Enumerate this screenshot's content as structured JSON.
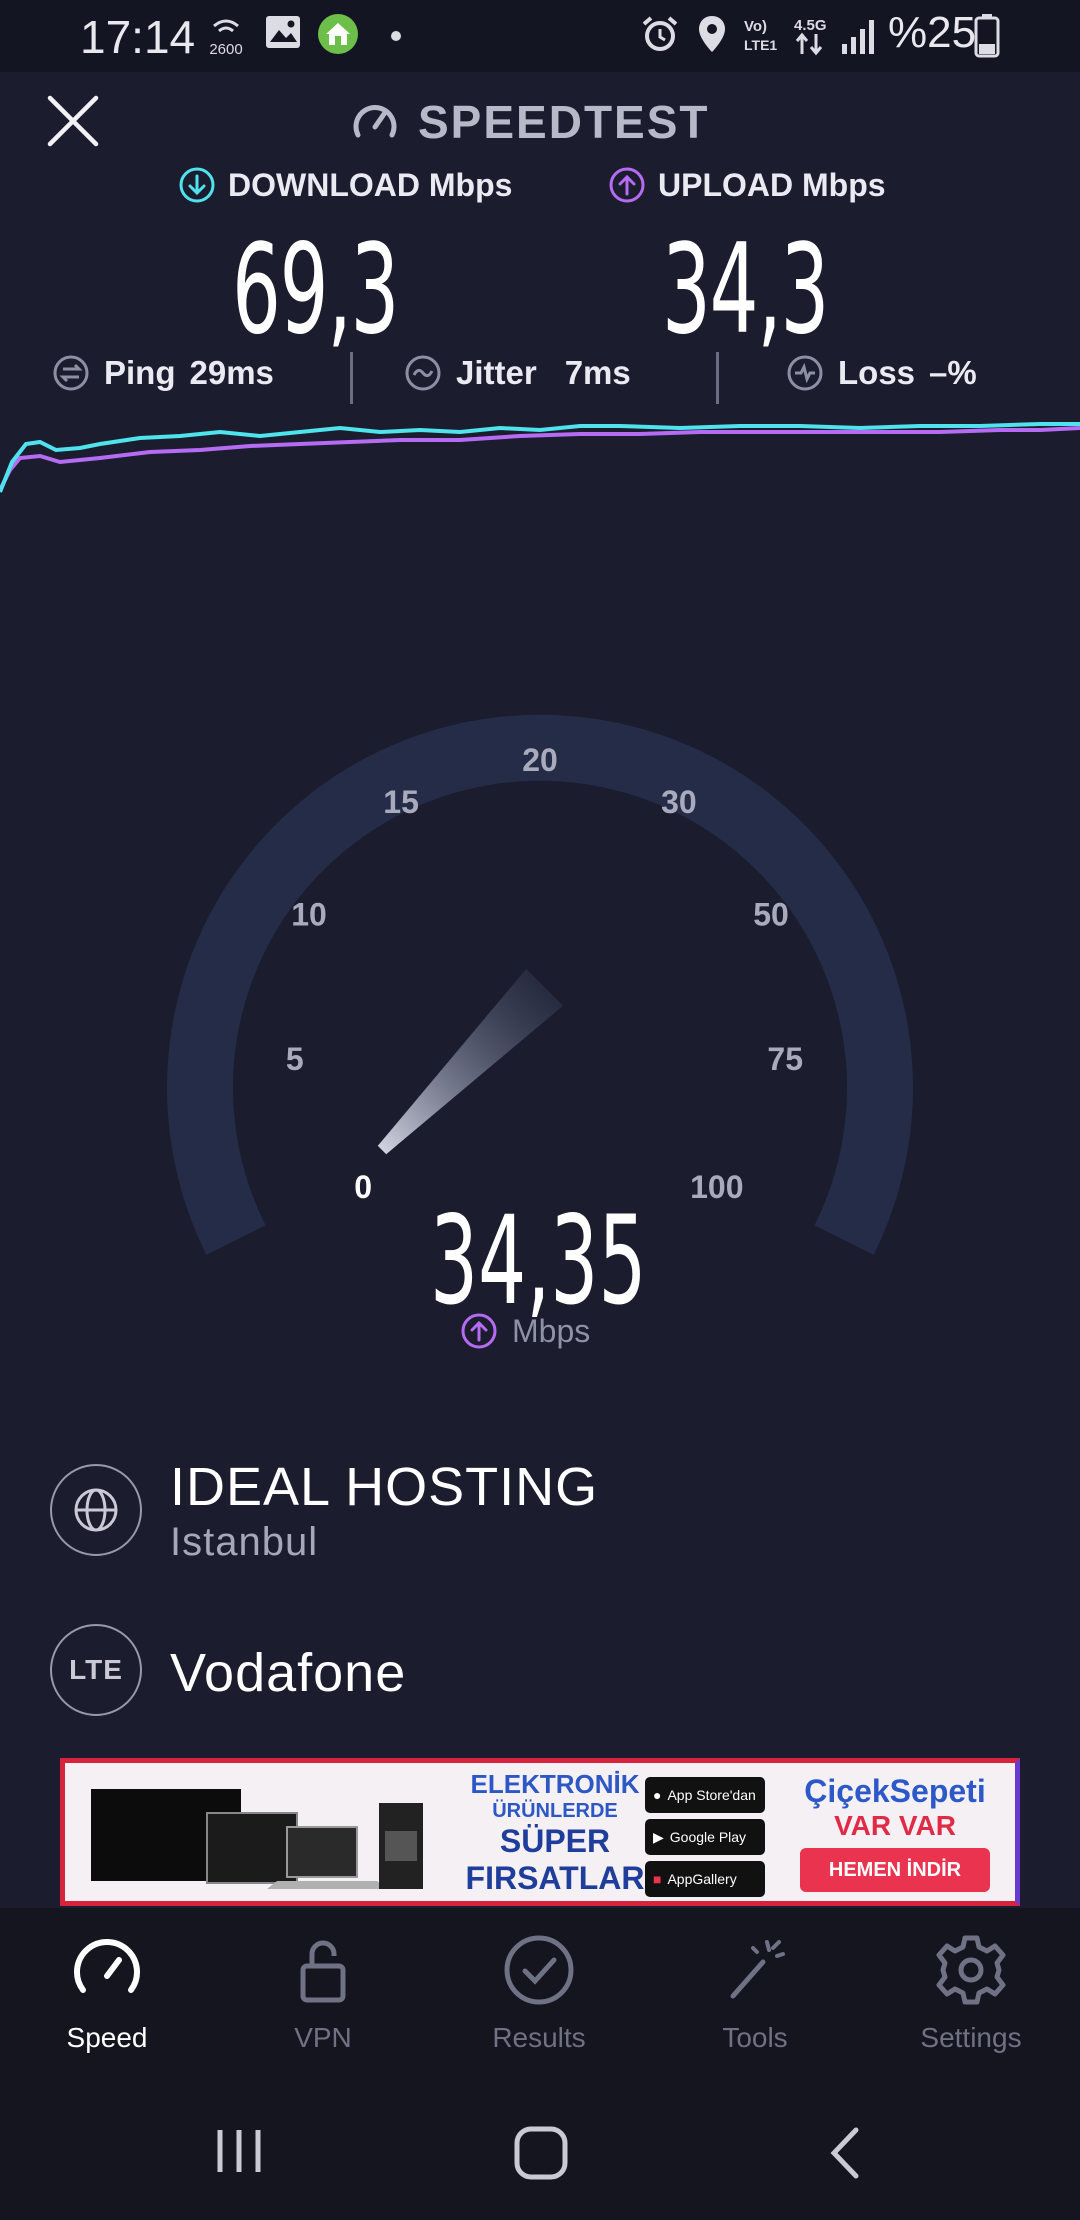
{
  "status_bar": {
    "time": "17:14",
    "network_badge": "2600",
    "signal_label": "Vo) LTE1",
    "network_type": "4.5G",
    "battery": "%25"
  },
  "header": {
    "title": "SPEEDTEST"
  },
  "metrics": {
    "download_label": "DOWNLOAD Mbps",
    "download_value": "69,3",
    "upload_label": "UPLOAD Mbps",
    "upload_value": "34,3",
    "ping_label": "Ping",
    "ping_value": "29ms",
    "jitter_label": "Jitter",
    "jitter_value": "7ms",
    "loss_label": "Loss",
    "loss_value": "–%"
  },
  "gauge": {
    "ticks": [
      "0",
      "5",
      "10",
      "15",
      "20",
      "30",
      "50",
      "75",
      "100"
    ],
    "reading": "34,35",
    "unit": "Mbps",
    "needle_value_mbps": 34.35
  },
  "server": {
    "name": "IDEAL HOSTING",
    "city": "Istanbul"
  },
  "provider": {
    "badge": "LTE",
    "name": "Vodafone"
  },
  "ad": {
    "line1": "ELEKTRONİK",
    "line2": "ÜRÜNLERDE",
    "line3": "SÜPER",
    "line4": "FIRSATLAR",
    "store1": "App Store'dan",
    "store2": "Google Play",
    "store3": "AppGallery",
    "brand": "ÇiçekSepeti",
    "brand_sub": "VAR VAR",
    "cta": "HEMEN İNDİR"
  },
  "nav": {
    "items": [
      {
        "label": "Speed",
        "icon": "speedometer-icon",
        "active": true
      },
      {
        "label": "VPN",
        "icon": "lock-icon",
        "active": false
      },
      {
        "label": "Results",
        "icon": "check-circle-icon",
        "active": false
      },
      {
        "label": "Tools",
        "icon": "magic-wand-icon",
        "active": false
      },
      {
        "label": "Settings",
        "icon": "gear-icon",
        "active": false
      }
    ]
  },
  "colors": {
    "background": "#1b1d2e",
    "download_accent": "#4fe3ee",
    "upload_accent": "#b56cf3",
    "gauge_track": "#242c47"
  }
}
